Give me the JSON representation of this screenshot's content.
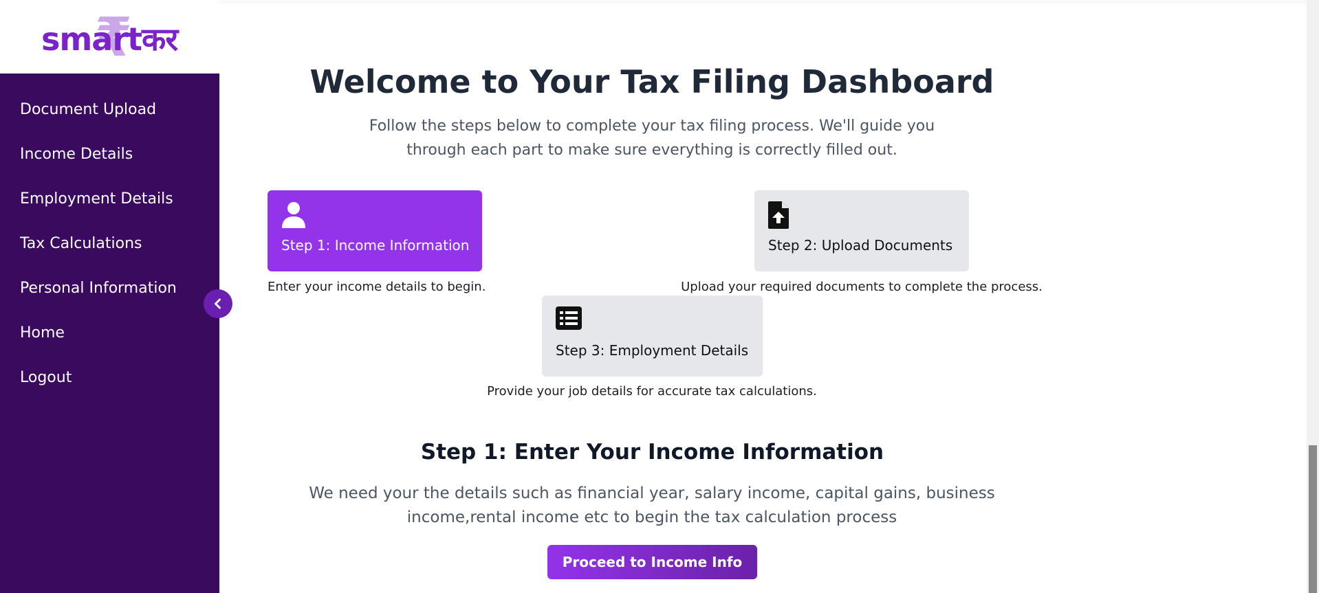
{
  "logo": {
    "prefix": "smart",
    "suffix": "कर",
    "symbol": "₹"
  },
  "sidebar": {
    "items": [
      {
        "label": "Document Upload"
      },
      {
        "label": "Income Details"
      },
      {
        "label": "Employment Details"
      },
      {
        "label": "Tax Calculations"
      },
      {
        "label": "Personal Information"
      },
      {
        "label": "Home"
      },
      {
        "label": "Logout"
      }
    ],
    "collapse_icon": "chevron-left-icon"
  },
  "main": {
    "title": "Welcome to Your Tax Filing Dashboard",
    "subtitle": "Follow the steps below to complete your tax filing process. We'll guide you through each part to make sure everything is correctly filled out."
  },
  "steps": [
    {
      "label": "Step 1: Income Information",
      "desc": "Enter your income details to begin.",
      "icon": "user-icon",
      "active": true
    },
    {
      "label": "Step 2: Upload Documents",
      "desc": "Upload your required documents to complete the process.",
      "icon": "file-upload-icon",
      "active": false
    },
    {
      "label": "Step 3: Employment Details",
      "desc": "Provide your job details for accurate tax calculations.",
      "icon": "list-icon",
      "active": false
    }
  ],
  "section": {
    "title": "Step 1: Enter Your Income Information",
    "desc": "We need your the details such as financial year, salary income, capital gains, business income,rental income etc to begin the tax calculation process",
    "button": "Proceed to Income Info"
  },
  "colors": {
    "sidebar_bg": "#3a0a5e",
    "accent": "#9333ea",
    "inactive_card": "#e5e7eb"
  }
}
